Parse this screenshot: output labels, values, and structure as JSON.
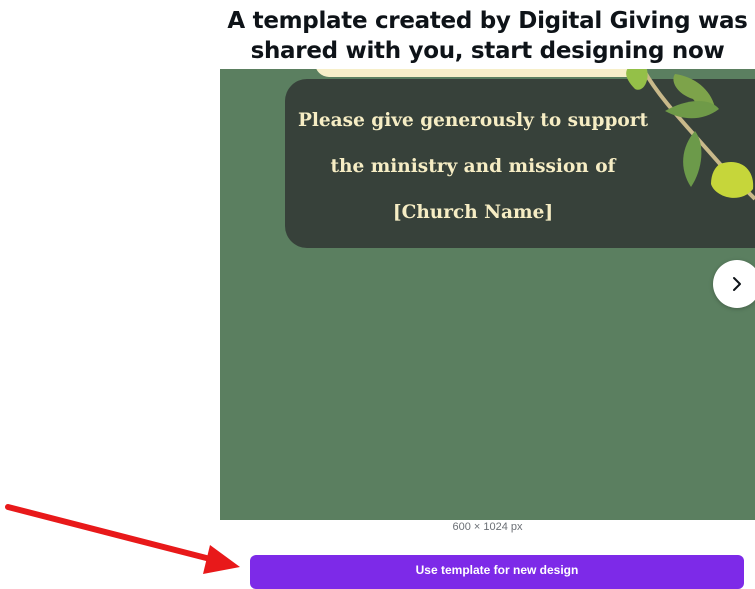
{
  "header": {
    "title_line1": "A template created by Digital Giving was",
    "title_line2": "shared with you, start designing now"
  },
  "preview": {
    "message_lines": [
      "Please give generously to support",
      "the ministry and mission of",
      "[Church Name]"
    ],
    "dimensions_label": "600 × 1024 px",
    "colors": {
      "background": "#5b7f60",
      "card": "#37413a",
      "text": "#f6edc4"
    }
  },
  "actions": {
    "use_template_label": "Use template for new design",
    "next_icon": "chevron-right-icon"
  },
  "colors": {
    "accent": "#7d2ae8",
    "annotation_arrow": "#e8191a"
  }
}
